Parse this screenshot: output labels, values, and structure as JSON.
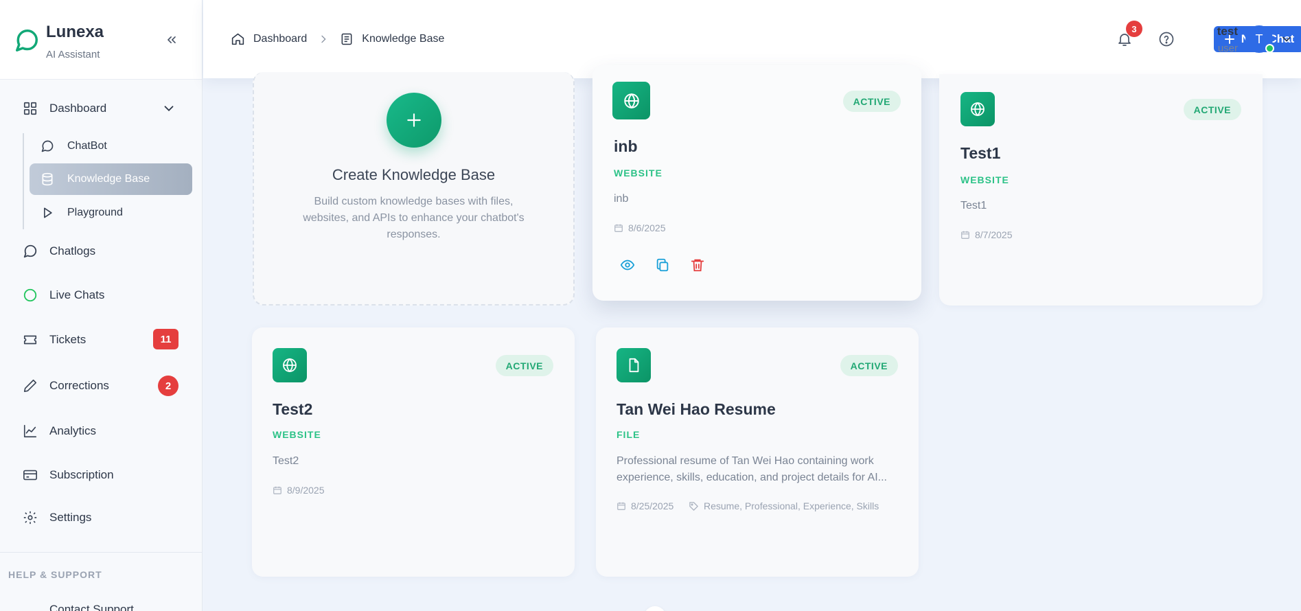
{
  "app": {
    "name": "Lunexa",
    "subtitle": "AI Assistant"
  },
  "sidebar": {
    "dashboard": "Dashboard",
    "sub_items": [
      {
        "label": "ChatBot"
      },
      {
        "label": "Knowledge Base",
        "active": true
      },
      {
        "label": "Playground"
      }
    ],
    "items": [
      {
        "label": "Chatlogs"
      },
      {
        "label": "Live Chats"
      },
      {
        "label": "Tickets",
        "badge": "11"
      },
      {
        "label": "Corrections",
        "badge": "2"
      },
      {
        "label": "Analytics"
      },
      {
        "label": "Subscription"
      },
      {
        "label": "Settings"
      }
    ],
    "section_label": "HELP & SUPPORT",
    "cut_item": "Contact Support"
  },
  "header": {
    "breadcrumb": [
      "Dashboard",
      "Knowledge Base"
    ],
    "new_chat": "New Chat",
    "notifications": "3",
    "user": {
      "name": "test",
      "role": "user",
      "initial": "T"
    }
  },
  "create_card": {
    "title": "Create Knowledge Base",
    "desc": "Build custom knowledge bases with files, websites, and APIs to enhance your chatbot's responses."
  },
  "cards": [
    {
      "title": "inb",
      "type": "WEBSITE",
      "status": "ACTIVE",
      "desc": "inb",
      "date": "8/6/2025"
    },
    {
      "title": "Test1",
      "type": "WEBSITE",
      "status": "ACTIVE",
      "desc": "Test1",
      "date": "8/7/2025"
    },
    {
      "title": "Test2",
      "type": "WEBSITE",
      "status": "ACTIVE",
      "desc": "Test2",
      "date": "8/9/2025"
    },
    {
      "title": "Tan Wei Hao Resume",
      "type": "FILE",
      "status": "ACTIVE",
      "desc": "Professional resume of Tan Wei Hao containing work experience, skills, education, and project details for AI...",
      "date": "8/25/2025",
      "tags": "Resume, Professional, Experience, Skills"
    }
  ],
  "colors": {
    "accent": "#2e6be6",
    "brand_green": "#12a877",
    "badge_red": "#e53e3e"
  }
}
